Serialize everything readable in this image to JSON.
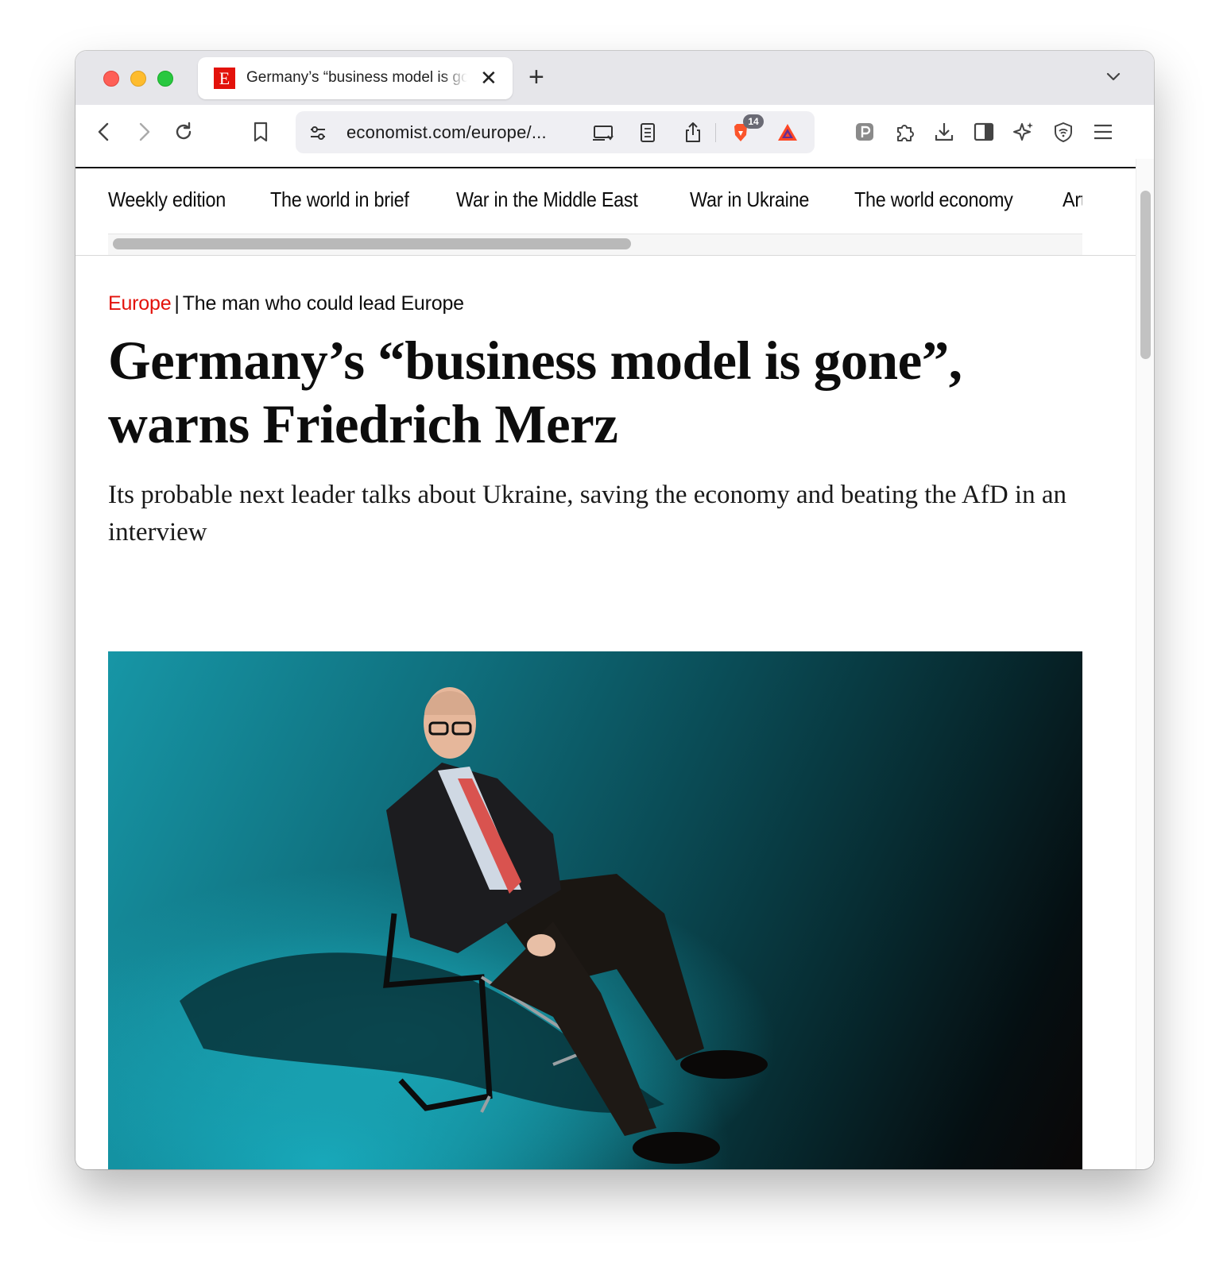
{
  "browser": {
    "tab": {
      "favicon": "E",
      "title": "Germany’s “business model is gone”, warns Friedrich Merz"
    },
    "url": "economist.com/europe/...",
    "shield_badge": "14",
    "icons": {
      "back": "chevron-left-icon",
      "forward": "chevron-right-icon",
      "reload": "reload-icon",
      "bookmark": "bookmark-icon",
      "site_settings": "sliders-icon",
      "cast": "cast-icon",
      "reader": "reader-mode-icon",
      "share": "share-icon",
      "brave": "brave-lion-icon",
      "rewards": "rewards-triangle-icon",
      "password": "password-manager-icon",
      "extensions": "puzzle-icon",
      "download": "download-icon",
      "sidebar": "sidebar-icon",
      "leo": "ai-sparkle-icon",
      "vpn": "vpn-shield-icon",
      "menu": "hamburger-icon"
    }
  },
  "site": {
    "nav": [
      "Weekly edition",
      "The world in brief",
      "War in the Middle East",
      "War in Ukraine",
      "The world economy",
      "Artifi"
    ]
  },
  "article": {
    "section": "Europe",
    "separator": "|",
    "fly_title": "The man who could lead Europe",
    "headline": "Germany’s “business model is gone”, warns Friedrich Merz",
    "standfirst": "Its probable next leader talks about Ukraine, saving the economy and beating the AfD in an interview"
  },
  "colors": {
    "brand_red": "#e3120b",
    "hero_teal": "#1796a6"
  }
}
